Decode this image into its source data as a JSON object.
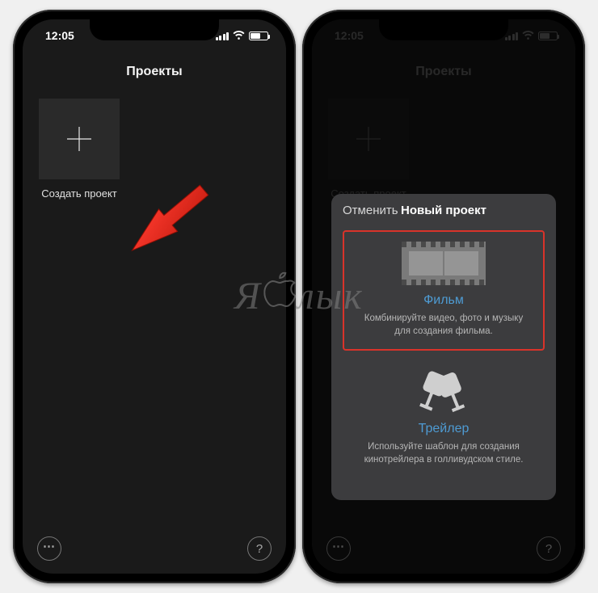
{
  "statusbar": {
    "time": "12:05"
  },
  "nav": {
    "title": "Проекты"
  },
  "project_tile": {
    "label": "Создать проект"
  },
  "sheet": {
    "cancel": "Отменить",
    "title": "Новый проект",
    "movie": {
      "title": "Фильм",
      "desc": "Комбинируйте видео, фото и музыку для создания фильма."
    },
    "trailer": {
      "title": "Трейлер",
      "desc": "Используйте шаблон для создания кинотрейлера в голливудском стиле."
    }
  },
  "watermark": {
    "left": "Я",
    "right": "лык"
  }
}
